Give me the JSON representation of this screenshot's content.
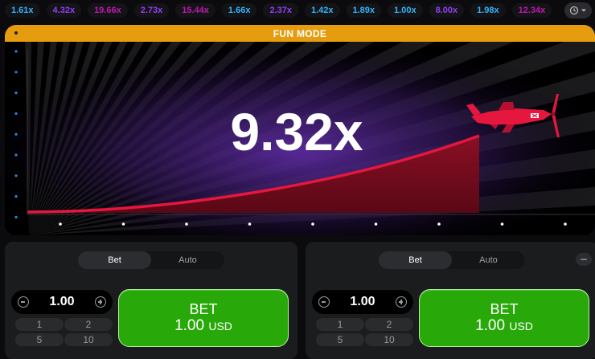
{
  "history": {
    "items": [
      {
        "value": "1.61x",
        "color": "#34b4ff"
      },
      {
        "value": "4.32x",
        "color": "#913ef8"
      },
      {
        "value": "19.66x",
        "color": "#c017b4"
      },
      {
        "value": "2.73x",
        "color": "#913ef8"
      },
      {
        "value": "15.44x",
        "color": "#c017b4"
      },
      {
        "value": "1.66x",
        "color": "#34b4ff"
      },
      {
        "value": "2.37x",
        "color": "#913ef8"
      },
      {
        "value": "1.42x",
        "color": "#34b4ff"
      },
      {
        "value": "1.89x",
        "color": "#34b4ff"
      },
      {
        "value": "1.00x",
        "color": "#34b4ff"
      },
      {
        "value": "8.00x",
        "color": "#913ef8"
      },
      {
        "value": "1.98x",
        "color": "#34b4ff"
      },
      {
        "value": "12.34x",
        "color": "#c017b4"
      }
    ],
    "toggle_icons": [
      "history-icon",
      "chevron-down-icon"
    ]
  },
  "game": {
    "banner": "FUN MODE",
    "multiplier": "9.32x",
    "curve_color": "#e5173f",
    "banner_color": "#e59c0f"
  },
  "panels": [
    {
      "tabs": [
        {
          "label": "Bet",
          "active": true
        },
        {
          "label": "Auto",
          "active": false
        }
      ],
      "amount": "1.00",
      "quick_amounts": [
        "1",
        "2",
        "5",
        "10"
      ],
      "bet_label": "BET",
      "bet_amount": "1.00",
      "currency": "USD"
    },
    {
      "tabs": [
        {
          "label": "Bet",
          "active": true
        },
        {
          "label": "Auto",
          "active": false
        }
      ],
      "amount": "1.00",
      "quick_amounts": [
        "1",
        "2",
        "5",
        "10"
      ],
      "bet_label": "BET",
      "bet_amount": "1.00",
      "currency": "USD"
    }
  ]
}
